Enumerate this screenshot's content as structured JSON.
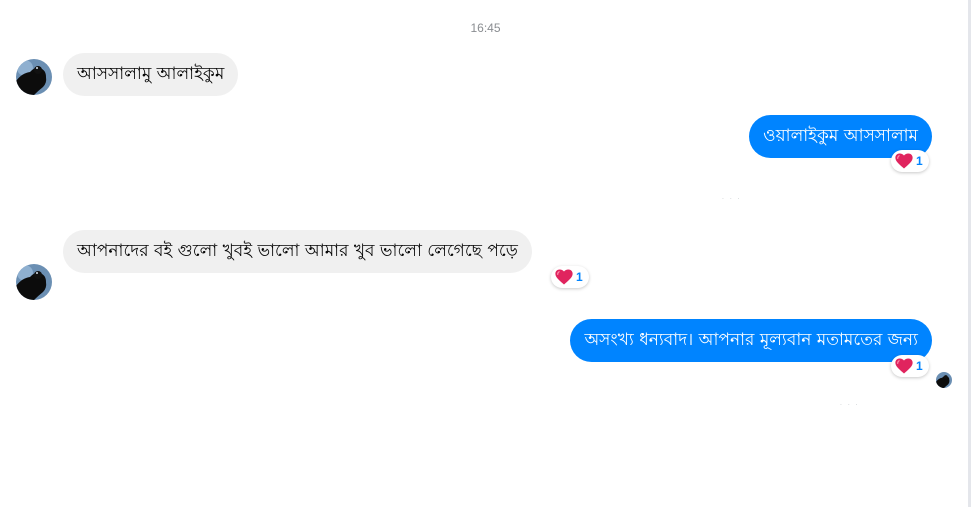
{
  "timestamp": "16:45",
  "colors": {
    "incoming_bubble": "#f0f0f0",
    "outgoing_bubble": "#0084ff",
    "reaction_count": "#0084ff"
  },
  "messages": [
    {
      "direction": "incoming",
      "text": "আসসালামু আলাইকুম"
    },
    {
      "direction": "outgoing",
      "text": "ওয়ালাইকুম আসসালাম",
      "reaction": {
        "emoji": "heart-icon",
        "count": "1"
      }
    },
    {
      "direction": "incoming",
      "text": "আপনাদের বই গুলো খুবই ভালো আমার খুব ভালো লেগেছে পড়ে",
      "reaction": {
        "emoji": "heart-icon",
        "count": "1"
      }
    },
    {
      "direction": "outgoing",
      "text": "অসংখ্য ধন্যবাদ। আপনার মূল্যবান মতামতের জন্য",
      "reaction": {
        "emoji": "heart-icon",
        "count": "1"
      }
    }
  ]
}
